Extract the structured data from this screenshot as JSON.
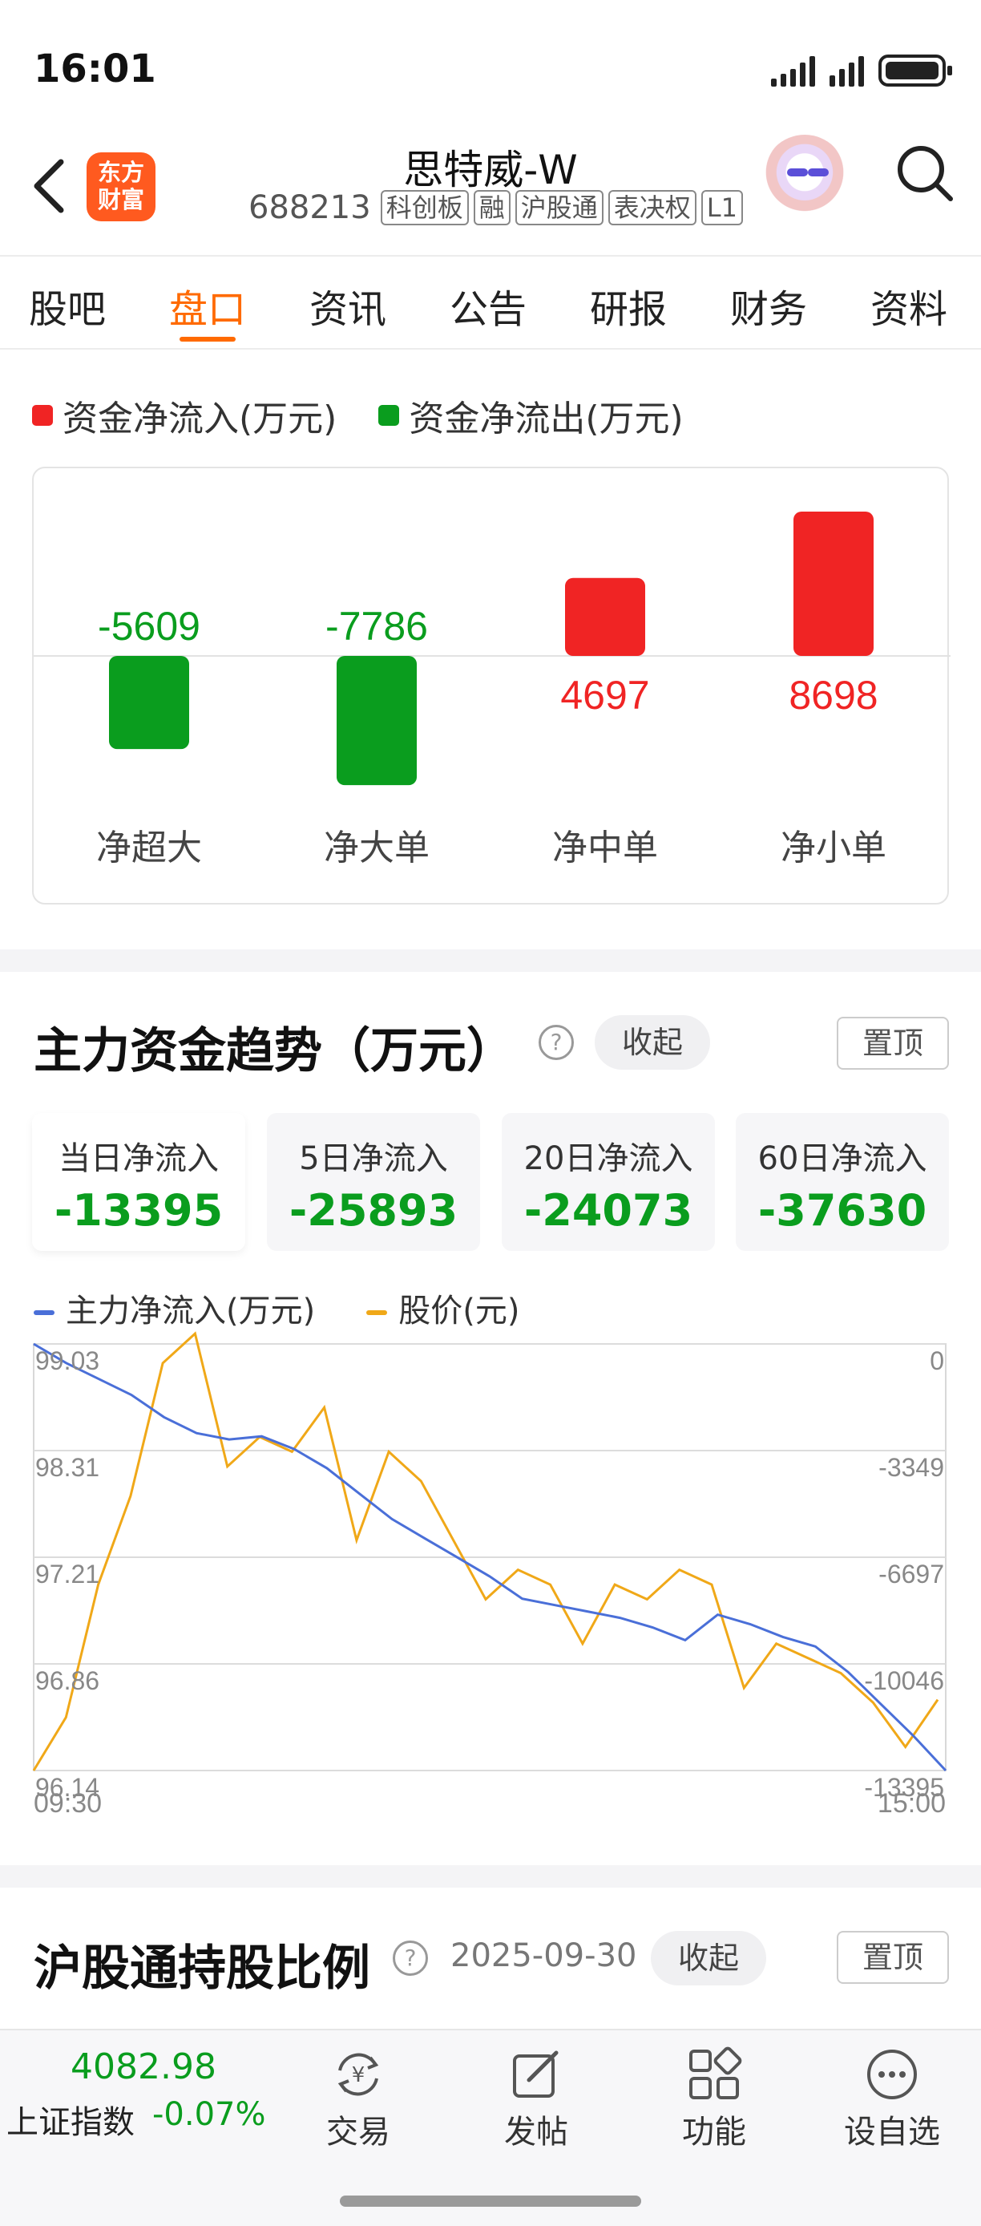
{
  "status_bar": {
    "time": "16:01"
  },
  "header": {
    "logo_line1": "东方",
    "logo_line2": "财富",
    "title": "思特威-W",
    "code": "688213",
    "tags": [
      "科创板",
      "融",
      "沪股通",
      "表决权",
      "L1"
    ]
  },
  "tabs": [
    "股吧",
    "盘口",
    "资讯",
    "公告",
    "研报",
    "财务",
    "资料"
  ],
  "active_tab": 1,
  "fund_flow": {
    "legend_in": "资金净流入(万元)",
    "legend_out": "资金净流出(万元)",
    "colors": {
      "in": "#f02424",
      "out": "#0a9d1e"
    },
    "chart_data": {
      "type": "bar",
      "categories": [
        "净超大",
        "净大单",
        "净中单",
        "净小单"
      ],
      "values": [
        -5609,
        -7786,
        4697,
        8698
      ],
      "value_labels": [
        "-5609",
        "-7786",
        "4697",
        "8698"
      ]
    }
  },
  "trend": {
    "title": "主力资金趋势（万元）",
    "help": "?",
    "collapse": "收起",
    "pin": "置顶",
    "stats": [
      {
        "label": "当日净流入",
        "value": "-13395"
      },
      {
        "label": "5日净流入",
        "value": "-25893"
      },
      {
        "label": "20日净流入",
        "value": "-24073"
      },
      {
        "label": "60日净流入",
        "value": "-37630"
      }
    ],
    "legend_main": "主力净流入(万元)",
    "legend_price": "股价(元)",
    "colors": {
      "main": "#4a6fd8",
      "price": "#f0a818"
    },
    "chart_data": {
      "type": "line",
      "x_start": "09:30",
      "x_end": "15:00",
      "left_axis_ticks": [
        "99.03",
        "98.31",
        "97.21",
        "96.86",
        "96.14"
      ],
      "right_axis_ticks": [
        "0",
        "-3349",
        "-6697",
        "-10046",
        "-13395"
      ],
      "series": [
        {
          "name": "主力净流入(万元)",
          "values": [
            0,
            -600,
            -1100,
            -1600,
            -2300,
            -2800,
            -3000,
            -2900,
            -3300,
            -3900,
            -4700,
            -5500,
            -6100,
            -6700,
            -7300,
            -8000,
            -8200,
            -8400,
            -8600,
            -8900,
            -9300,
            -8500,
            -8800,
            -9200,
            -9500,
            -10300,
            -11300,
            -12300,
            -13395
          ]
        },
        {
          "name": "股价(元)",
          "values": [
            96.14,
            96.5,
            97.4,
            98.0,
            98.9,
            99.1,
            98.2,
            98.4,
            98.3,
            98.6,
            97.7,
            98.3,
            98.1,
            97.7,
            97.3,
            97.5,
            97.4,
            97.0,
            97.4,
            97.3,
            97.5,
            97.4,
            96.7,
            97.0,
            96.9,
            96.8,
            96.6,
            96.3,
            96.62
          ]
        }
      ]
    }
  },
  "hk_connect": {
    "title": "沪股通持股比例",
    "help": "?",
    "date": "2025-09-30",
    "collapse": "收起",
    "pin": "置顶"
  },
  "bottom_bar": {
    "index_value": "4082.98",
    "index_name": "上证指数",
    "index_change": "-0.07%",
    "nav": [
      {
        "label": "交易",
        "icon": "exchange-yen-icon"
      },
      {
        "label": "发帖",
        "icon": "edit-post-icon"
      },
      {
        "label": "功能",
        "icon": "grid-apps-icon"
      },
      {
        "label": "设自选",
        "icon": "more-dots-icon"
      }
    ]
  }
}
